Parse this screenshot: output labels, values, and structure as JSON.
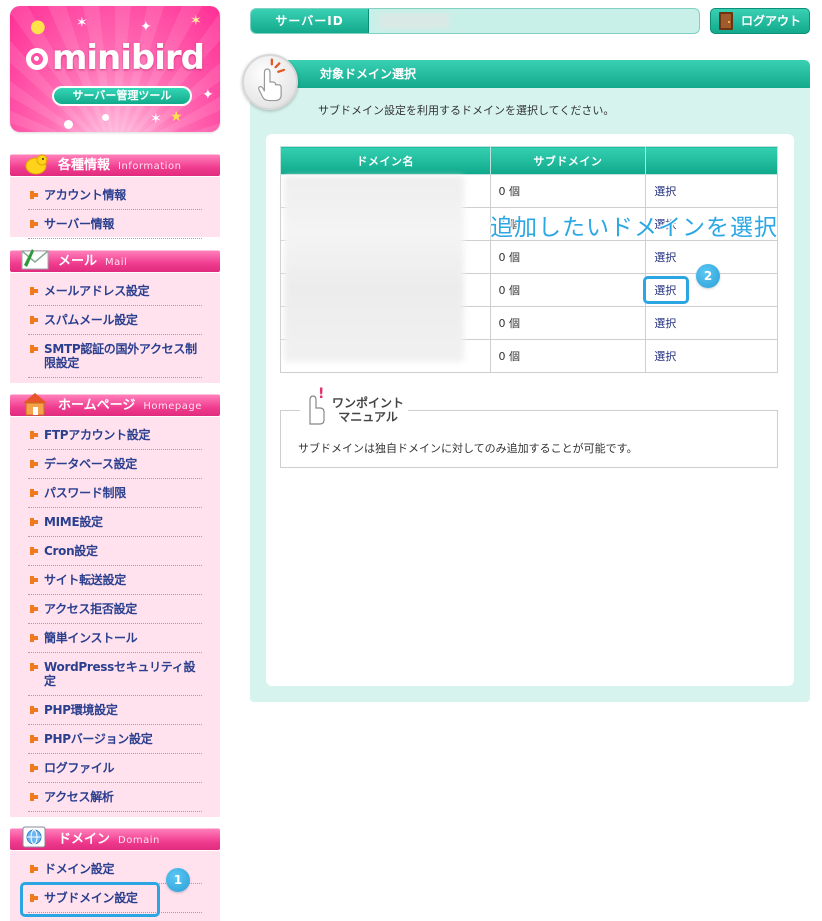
{
  "logo": {
    "brand": "minibird",
    "tagline": "サーバー管理ツール"
  },
  "header": {
    "server_id_label": "サーバーID",
    "server_id_value": "",
    "logout_label": "ログアウト"
  },
  "sidebar": {
    "sections": [
      {
        "title": "各種情報",
        "en": "Information",
        "items": [
          "アカウント情報",
          "サーバー情報"
        ]
      },
      {
        "title": "メール",
        "en": "Mail",
        "items": [
          "メールアドレス設定",
          "スパムメール設定",
          "SMTP認証の国外アクセス制限設定"
        ]
      },
      {
        "title": "ホームページ",
        "en": "Homepage",
        "items": [
          "FTPアカウント設定",
          "データベース設定",
          "パスワード制限",
          "MIME設定",
          "Cron設定",
          "サイト転送設定",
          "アクセス拒否設定",
          "簡単インストール",
          "WordPressセキュリティ設定",
          "PHP環境設定",
          "PHPバージョン設定",
          "ログファイル",
          "アクセス解析"
        ]
      },
      {
        "title": "ドメイン",
        "en": "Domain",
        "items": [
          "ドメイン設定",
          "サブドメイン設定"
        ]
      }
    ]
  },
  "main": {
    "title": "対象ドメイン選択",
    "description": "サブドメイン設定を利用するドメインを選択してください。",
    "table": {
      "headers": [
        "ドメイン名",
        "サブドメイン",
        ""
      ],
      "rows": [
        {
          "domain": "",
          "count": "0 個",
          "action": "選択"
        },
        {
          "domain": "",
          "count": "0 個",
          "action": "選択"
        },
        {
          "domain": "",
          "count": "0 個",
          "action": "選択"
        },
        {
          "domain": "",
          "count": "0 個",
          "action": "選択"
        },
        {
          "domain": "",
          "count": "0 個",
          "action": "選択"
        },
        {
          "domain": "",
          "count": "0 個",
          "action": "選択"
        }
      ]
    },
    "tip": {
      "title_line1": "ワンポイント",
      "title_line2": "マニュアル",
      "text": "サブドメインは独自ドメインに対してのみ追加することが可能です。"
    }
  },
  "annotations": {
    "callout": "追加したいドメインを選択",
    "badge1": "1",
    "badge2": "2"
  },
  "colors": {
    "accent": "#12a98d",
    "pink": "#f03c8f",
    "highlight": "#2ba6e2"
  }
}
